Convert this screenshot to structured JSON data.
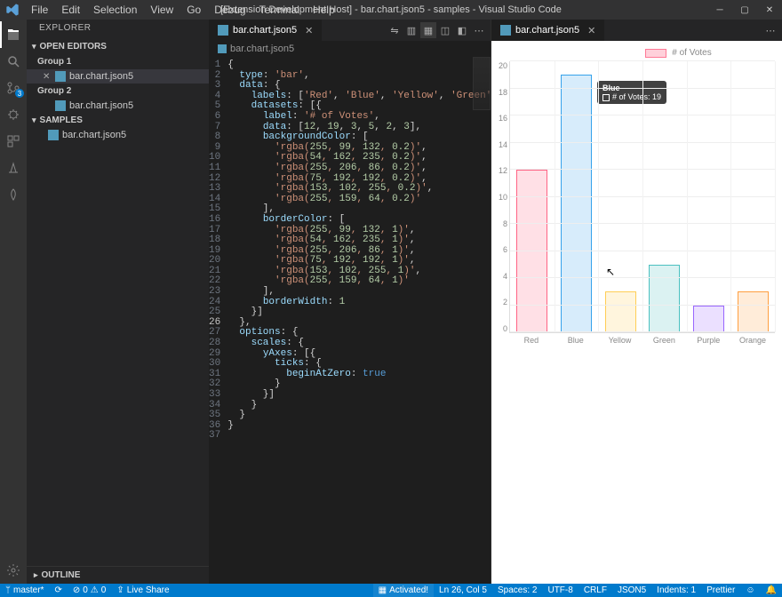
{
  "window": {
    "title": "[Extension Development Host] - bar.chart.json5 - samples - Visual Studio Code"
  },
  "menu": [
    "File",
    "Edit",
    "Selection",
    "View",
    "Go",
    "Debug",
    "Terminal",
    "Help"
  ],
  "sidebar": {
    "title": "Explorer",
    "open_editors": "Open Editors",
    "group1": "Group 1",
    "group2": "Group 2",
    "samples": "samples",
    "file": "bar.chart.json5",
    "outline": "Outline"
  },
  "tabs": {
    "left_file": "bar.chart.json5",
    "right_file": "bar.chart.json5",
    "breadcrumb": "bar.chart.json5"
  },
  "status": {
    "branch": "master*",
    "sync": "⟳",
    "errors": "0",
    "warnings": "0",
    "liveshare": "Live Share",
    "activated": "Activated!",
    "position": "Ln 26, Col 5",
    "spaces": "Spaces: 2",
    "encoding": "UTF-8",
    "eol": "CRLF",
    "lang": "JSON5",
    "indents": "Indents: 1",
    "prettier": "Prettier",
    "feedback": "☺",
    "bell": "🔔"
  },
  "tooltip": {
    "title": "Blue",
    "label": "# of Votes: 19"
  },
  "chart_legend": "# of Votes",
  "chart_data": {
    "type": "bar",
    "title": "",
    "legend": "# of Votes",
    "categories": [
      "Red",
      "Blue",
      "Yellow",
      "Green",
      "Purple",
      "Orange"
    ],
    "values": [
      12,
      19,
      3,
      5,
      2,
      3
    ],
    "backgroundColor": [
      "rgba(255,99,132,0.2)",
      "rgba(54,162,235,0.2)",
      "rgba(255,206,86,0.2)",
      "rgba(75,192,192,0.2)",
      "rgba(153,102,255,0.2)",
      "rgba(255,159,64,0.2)"
    ],
    "borderColor": [
      "rgba(255,99,132,1)",
      "rgba(54,162,235,1)",
      "rgba(255,206,86,1)",
      "rgba(75,192,192,1)",
      "rgba(153,102,255,1)",
      "rgba(255,159,64,1)"
    ],
    "borderWidth": 1,
    "ylim": [
      0,
      20
    ],
    "ytick": 2,
    "beginAtZero": true
  },
  "code_lines": [
    "{",
    "  type: 'bar',",
    "  data: {",
    "    labels: ['Red', 'Blue', 'Yellow', 'Green', 'Pur",
    "    datasets: [{",
    "      label: '# of Votes',",
    "      data: [12, 19, 3, 5, 2, 3],",
    "      backgroundColor: [",
    "        'rgba(255, 99, 132, 0.2)',",
    "        'rgba(54, 162, 235, 0.2)',",
    "        'rgba(255, 206, 86, 0.2)',",
    "        'rgba(75, 192, 192, 0.2)',",
    "        'rgba(153, 102, 255, 0.2)',",
    "        'rgba(255, 159, 64, 0.2)'",
    "      ],",
    "      borderColor: [",
    "        'rgba(255, 99, 132, 1)',",
    "        'rgba(54, 162, 235, 1)',",
    "        'rgba(255, 206, 86, 1)',",
    "        'rgba(75, 192, 192, 1)',",
    "        'rgba(153, 102, 255, 1)',",
    "        'rgba(255, 159, 64, 1)'",
    "      ],",
    "      borderWidth: 1",
    "    }]",
    "  },",
    "  options: {",
    "    scales: {",
    "      yAxes: [{",
    "        ticks: {",
    "          beginAtZero: true",
    "        }",
    "      }]",
    "    }",
    "  }",
    "}",
    ""
  ]
}
